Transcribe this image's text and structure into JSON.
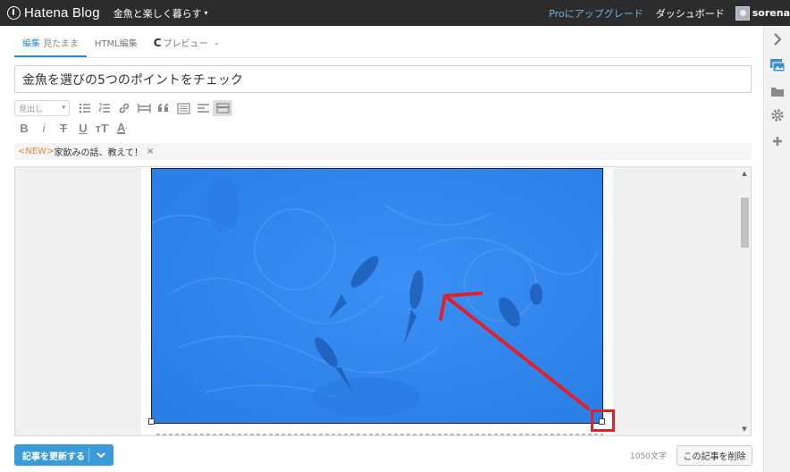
{
  "header": {
    "logo_text": "Hatena Blog",
    "blog_title": "金魚と楽しく暮らす",
    "pro_link": "Proにアップグレード",
    "dashboard_link": "ダッシュボード",
    "user_name": "sorena"
  },
  "tabs": [
    {
      "label": "編集",
      "sub": "見たまま"
    },
    {
      "label": "HTML編集"
    },
    {
      "label": "プレビュー"
    }
  ],
  "editor": {
    "title_value": "金魚を選びの5つのポイントをチェック",
    "heading_select": "見出し",
    "toolbar_icons": [
      "bulleted-list-icon",
      "numbered-list-icon",
      "link-icon",
      "table-icon",
      "quote-icon",
      "list-box-icon",
      "align-icon",
      "more-icon"
    ],
    "format_icons": [
      "bold-icon",
      "italic-icon",
      "strikethrough-icon",
      "underline-icon",
      "text-size-icon",
      "text-color-icon"
    ]
  },
  "tag_bar": {
    "new_label": "<NEW>",
    "text": "家飲みの話、教えて！",
    "close": "×"
  },
  "image": {
    "description_icon": "goldfish-photo",
    "tint_color": "#2e86ee",
    "annotation_color": "#e0202a"
  },
  "footer": {
    "update_label": "記事を更新する",
    "char_count": "1050文字",
    "delete_label": "この記事を削除"
  },
  "colors": {
    "topbar": "#2c2c2c",
    "accent": "#2d8cd0",
    "pro_link": "#6fb3e6",
    "button": "#3b9bd6"
  }
}
